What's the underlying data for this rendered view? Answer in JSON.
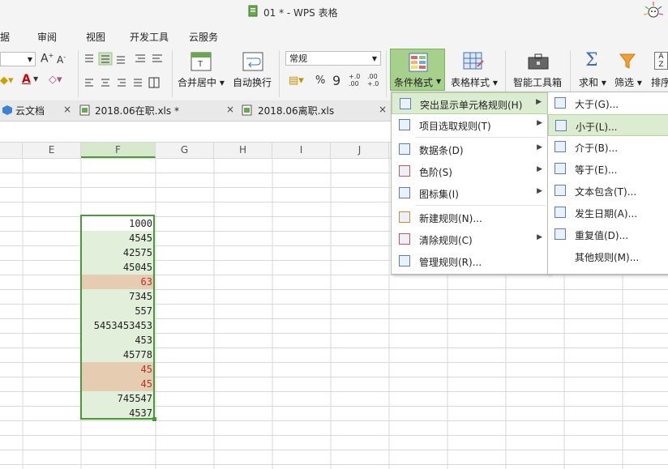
{
  "window": {
    "title": "01 * - WPS 表格"
  },
  "ribbon_tabs": [
    "据",
    "审阅",
    "视图",
    "开发工具",
    "云服务"
  ],
  "ribbon": {
    "merge_label": "合并居中",
    "wrap_label": "自动换行",
    "number_format": "常规",
    "percent": "%",
    "comma": "9",
    "cond_format_label": "条件格式",
    "table_style_label": "表格样式",
    "smart_toolbox_label": "智能工具箱",
    "sum_label": "求和",
    "filter_label": "筛选",
    "sort_label": "排序",
    "font_grow": "A",
    "font_shrink": "A"
  },
  "doc_tabs": [
    {
      "label": "云文档"
    },
    {
      "label": "2018.06在职.xls *"
    },
    {
      "label": "2018.06离职.xls"
    }
  ],
  "columns": [
    "E",
    "F",
    "G",
    "H",
    "I",
    "J"
  ],
  "cells": [
    {
      "value": "1000",
      "style": "white"
    },
    {
      "value": "4545",
      "style": "green"
    },
    {
      "value": "42575",
      "style": "green"
    },
    {
      "value": "45045",
      "style": "green"
    },
    {
      "value": "63",
      "style": "tan"
    },
    {
      "value": "7345",
      "style": "green"
    },
    {
      "value": "557",
      "style": "green"
    },
    {
      "value": "5453453453",
      "style": "green"
    },
    {
      "value": "453",
      "style": "green"
    },
    {
      "value": "45778",
      "style": "green"
    },
    {
      "value": "45",
      "style": "tan"
    },
    {
      "value": "45",
      "style": "tan"
    },
    {
      "value": "745547",
      "style": "green"
    },
    {
      "value": "4537",
      "style": "green"
    }
  ],
  "colors": {
    "green_fill": "#e2efda",
    "tan_fill": "#e6cdb1",
    "tan_text": "#b1352a",
    "selection_border": "#4a9a3a"
  },
  "cond_menu": {
    "items": [
      {
        "label": "突出显示单元格规则(H)",
        "submenu": true
      },
      {
        "label": "项目选取规则(T)",
        "submenu": true
      },
      {
        "label": "数据条(D)",
        "submenu": true
      },
      {
        "label": "色阶(S)",
        "submenu": true
      },
      {
        "label": "图标集(I)",
        "submenu": true
      },
      {
        "label": "新建规则(N)...",
        "submenu": false
      },
      {
        "label": "清除规则(C)",
        "submenu": true
      },
      {
        "label": "管理规则(R)...",
        "submenu": false
      }
    ]
  },
  "highlight_submenu": {
    "items": [
      {
        "label": "大于(G)..."
      },
      {
        "label": "小于(L)..."
      },
      {
        "label": "介于(B)..."
      },
      {
        "label": "等于(E)..."
      },
      {
        "label": "文本包含(T)..."
      },
      {
        "label": "发生日期(A)..."
      },
      {
        "label": "重复值(D)..."
      },
      {
        "label": "其他规则(M)..."
      }
    ]
  }
}
